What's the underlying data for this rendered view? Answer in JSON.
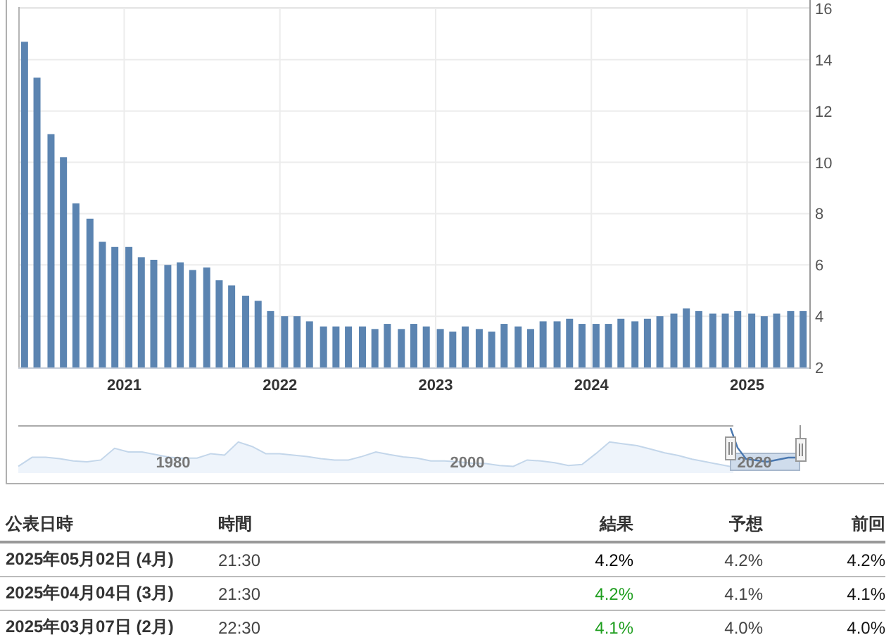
{
  "chart": {
    "chart_data": {
      "type": "bar",
      "x": [
        2020.36,
        2020.44,
        2020.53,
        2020.61,
        2020.69,
        2020.78,
        2020.86,
        2020.94,
        2021.03,
        2021.11,
        2021.19,
        2021.28,
        2021.36,
        2021.44,
        2021.53,
        2021.61,
        2021.69,
        2021.78,
        2021.86,
        2021.94,
        2022.03,
        2022.11,
        2022.19,
        2022.28,
        2022.36,
        2022.44,
        2022.53,
        2022.61,
        2022.69,
        2022.78,
        2022.86,
        2022.94,
        2023.03,
        2023.11,
        2023.19,
        2023.28,
        2023.36,
        2023.44,
        2023.53,
        2023.61,
        2023.69,
        2023.78,
        2023.86,
        2023.94,
        2024.03,
        2024.11,
        2024.19,
        2024.28,
        2024.36,
        2024.44,
        2024.53,
        2024.61,
        2024.69,
        2024.78,
        2024.86,
        2024.94,
        2025.03,
        2025.11,
        2025.19,
        2025.28,
        2025.36
      ],
      "series": [
        {
          "color": "#5b84b1",
          "values": [
            14.7,
            13.3,
            11.1,
            10.2,
            8.4,
            7.8,
            6.9,
            6.7,
            6.7,
            6.3,
            6.2,
            6.0,
            6.1,
            5.8,
            5.9,
            5.4,
            5.2,
            4.8,
            4.6,
            4.2,
            4.0,
            4.0,
            3.8,
            3.6,
            3.6,
            3.6,
            3.6,
            3.5,
            3.7,
            3.5,
            3.7,
            3.6,
            3.5,
            3.4,
            3.6,
            3.5,
            3.4,
            3.7,
            3.6,
            3.5,
            3.8,
            3.8,
            3.9,
            3.7,
            3.7,
            3.7,
            3.9,
            3.8,
            3.9,
            4.0,
            4.1,
            4.3,
            4.2,
            4.1,
            4.1,
            4.2,
            4.1,
            4.0,
            4.1,
            4.2,
            4.2
          ]
        }
      ],
      "xlim": [
        2020.32,
        2025.4
      ],
      "ylim": [
        2,
        16
      ],
      "grid": true,
      "xticks": [
        2021,
        2022,
        2023,
        2024,
        2025
      ],
      "yticks": [
        2,
        4,
        6,
        8,
        10,
        12,
        14,
        16
      ]
    }
  },
  "navigator": {
    "labels": [
      "1980",
      "2000",
      "2020"
    ]
  },
  "table": {
    "columns": [
      "公表日時",
      "時間",
      "結果",
      "予想",
      "前回"
    ],
    "rows": [
      {
        "date": "2025年05月02日 (4月)",
        "time": "21:30",
        "actual": "4.2%",
        "color": "#000000",
        "forecast": "4.2%",
        "previous": "4.2%"
      },
      {
        "date": "2025年04月04日 (3月)",
        "time": "21:30",
        "actual": "4.2%",
        "color": "#1e9e1e",
        "forecast": "4.1%",
        "previous": "4.1%"
      },
      {
        "date": "2025年03月07日 (2月)",
        "time": "22:30",
        "actual": "4.1%",
        "color": "#1e9e1e",
        "forecast": "4.0%",
        "previous": "4.0%"
      }
    ]
  }
}
